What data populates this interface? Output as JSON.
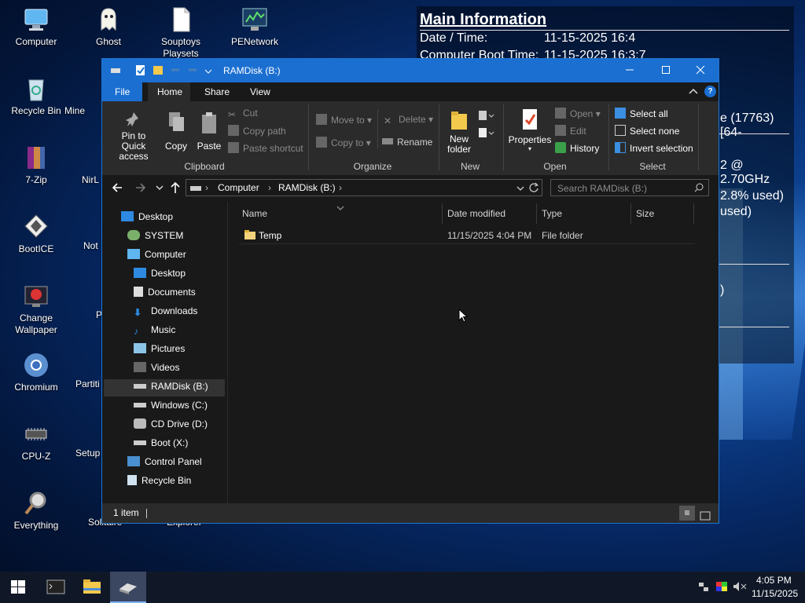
{
  "desktop": {
    "icons": [
      {
        "label": "Computer"
      },
      {
        "label": "Ghost"
      },
      {
        "label": "Souptoys Playsets"
      },
      {
        "label": "PENetwork"
      },
      {
        "label": "Recycle Bin"
      },
      {
        "label": "Mine"
      },
      {
        "label": "7-Zip"
      },
      {
        "label": "NirL"
      },
      {
        "label": "BootICE"
      },
      {
        "label": "Not"
      },
      {
        "label": "Change Wallpaper"
      },
      {
        "label": "P"
      },
      {
        "label": "Chromium"
      },
      {
        "label": "Partiti"
      },
      {
        "label": "CPU-Z"
      },
      {
        "label": "Setup"
      },
      {
        "label": "Everything"
      },
      {
        "label": "Solitaire"
      },
      {
        "label": "Explorer"
      }
    ]
  },
  "info_panel": {
    "title": "Main Information",
    "date_label": "Date / Time:",
    "date_value": "11-15-2025 16:4",
    "boot_label": "Computer Boot Time:",
    "boot_value": "11-15-2025 16:3:7",
    "frag_os": "e (17763) [64-",
    "frag_cpu": "2 @ 2.70GHz",
    "frag_mem": "2.8% used)",
    "frag_used": "used)",
    "frag_paren": ")"
  },
  "window": {
    "title": "RAMDisk (B:)",
    "tabs": [
      "File",
      "Home",
      "Share",
      "View"
    ],
    "ribbon": {
      "clipboard": {
        "pin": "Pin to Quick access",
        "copy": "Copy",
        "paste": "Paste",
        "cut": "Cut",
        "copy_path": "Copy path",
        "paste_shortcut": "Paste shortcut",
        "group": "Clipboard"
      },
      "organize": {
        "move_to": "Move to",
        "copy_to": "Copy to",
        "delete": "Delete",
        "rename": "Rename",
        "group": "Organize"
      },
      "new": {
        "new_folder": "New folder",
        "group": "New"
      },
      "open": {
        "properties": "Properties",
        "open": "Open",
        "edit": "Edit",
        "history": "History",
        "group": "Open"
      },
      "select": {
        "select_all": "Select all",
        "select_none": "Select none",
        "invert": "Invert selection",
        "group": "Select"
      }
    },
    "address": {
      "crumbs": [
        "Computer",
        "RAMDisk (B:)"
      ],
      "search_placeholder": "Search RAMDisk (B:)"
    },
    "nav": [
      {
        "label": "Desktop"
      },
      {
        "label": "SYSTEM"
      },
      {
        "label": "Computer"
      },
      {
        "label": "Desktop"
      },
      {
        "label": "Documents"
      },
      {
        "label": "Downloads"
      },
      {
        "label": "Music"
      },
      {
        "label": "Pictures"
      },
      {
        "label": "Videos"
      },
      {
        "label": "RAMDisk (B:)"
      },
      {
        "label": "Windows (C:)"
      },
      {
        "label": "CD Drive (D:)"
      },
      {
        "label": "Boot (X:)"
      },
      {
        "label": "Control Panel"
      },
      {
        "label": "Recycle Bin"
      }
    ],
    "columns": [
      "Name",
      "Date modified",
      "Type",
      "Size"
    ],
    "rows": [
      {
        "name": "Temp",
        "date": "11/15/2025 4:04 PM",
        "type": "File folder",
        "size": ""
      }
    ],
    "status": "1 item"
  },
  "taskbar": {
    "time": "4:05 PM",
    "date": "11/15/2025"
  }
}
